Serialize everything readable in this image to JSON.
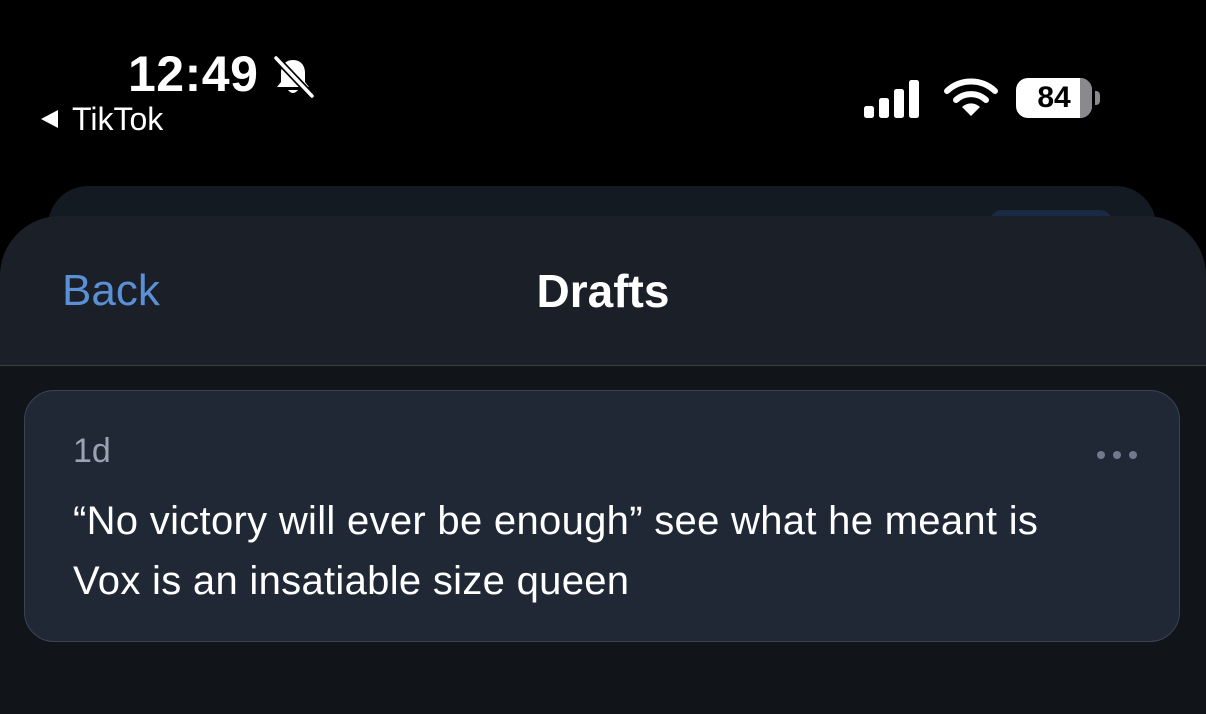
{
  "status_bar": {
    "time": "12:49",
    "back_app_label": "TikTok",
    "battery_percent": "84",
    "battery_level": 84,
    "icons": [
      "bell-slash-icon",
      "back-triangle-icon",
      "cellular-signal-icon",
      "wifi-icon",
      "battery-icon"
    ]
  },
  "sheet": {
    "back_label": "Back",
    "title": "Drafts"
  },
  "drafts": [
    {
      "age": "1d",
      "text": "“No victory will ever be enough” see what he meant is Vox is an insatiable size queen",
      "menu_icon": "more-horizontal-icon"
    }
  ],
  "colors": {
    "background": "#000000",
    "sheet_header": "#1b1f27",
    "card": "#202836",
    "accent": "#5b8fd6",
    "muted_text": "#9aa3b2"
  }
}
